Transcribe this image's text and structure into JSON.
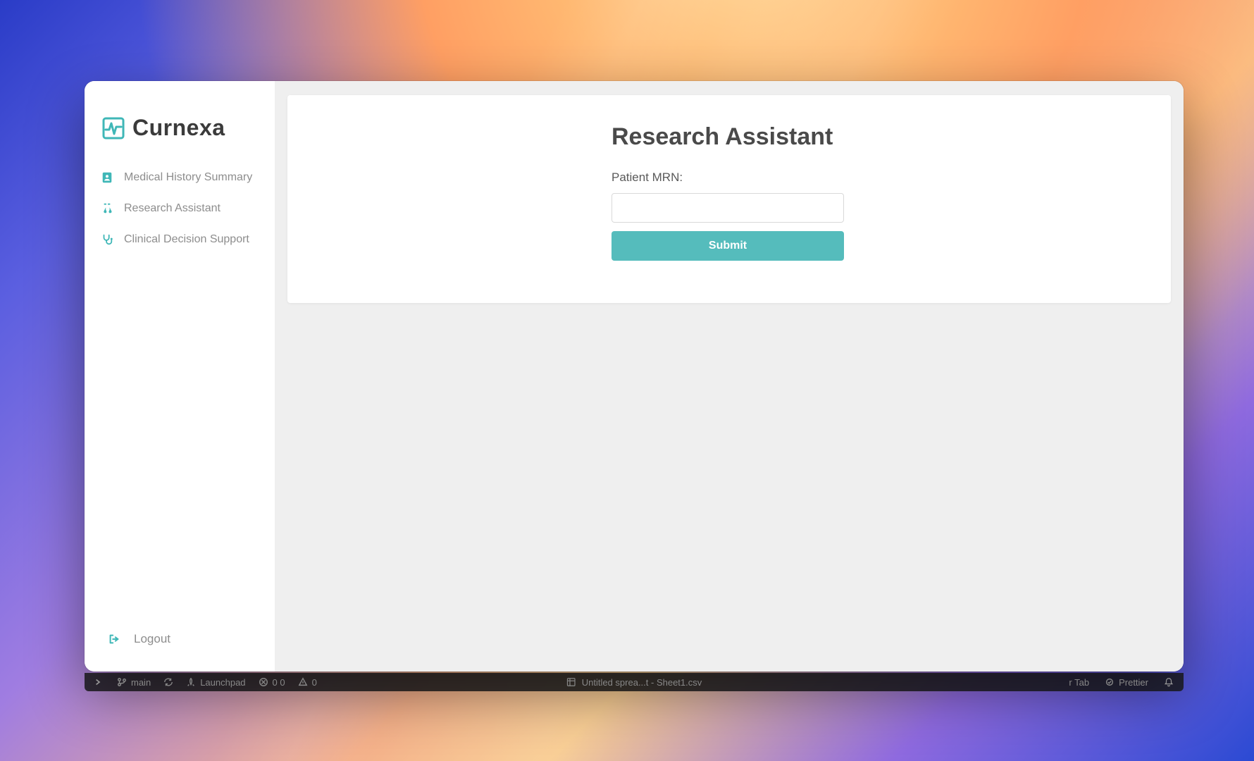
{
  "brand": {
    "name": "Curnexa"
  },
  "sidebar": {
    "items": [
      {
        "label": "Medical History Summary",
        "icon": "patient-card-icon"
      },
      {
        "label": "Research Assistant",
        "icon": "lab-flask-icon"
      },
      {
        "label": "Clinical Decision Support",
        "icon": "stethoscope-icon"
      }
    ],
    "logout_label": "Logout"
  },
  "main": {
    "title": "Research Assistant",
    "form": {
      "mrn_label": "Patient MRN:",
      "mrn_value": "",
      "submit_label": "Submit"
    }
  },
  "dock": {
    "branch_label": "main",
    "launchpad_label": "Launchpad",
    "counters_label": "0   0",
    "warn_label": "0",
    "file_label": "Untitled sprea...t - Sheet1.csv",
    "right": {
      "tab_label": "r Tab",
      "prettier_label": "Prettier"
    }
  },
  "colors": {
    "accent": "#3fb7b7",
    "submit": "#55bcbc"
  }
}
